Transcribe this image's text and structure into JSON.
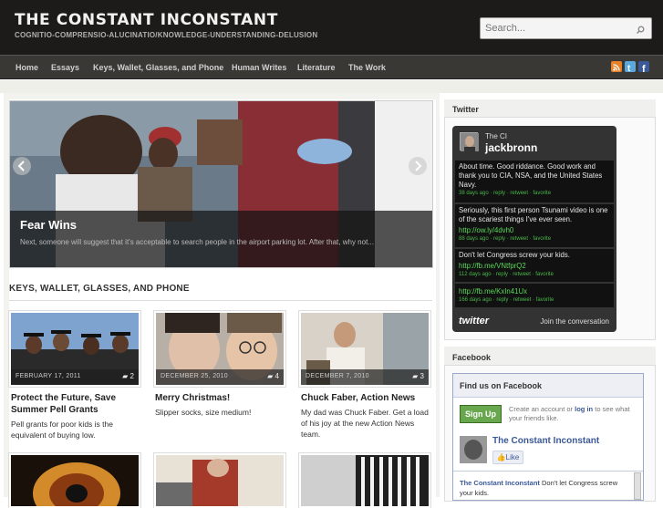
{
  "site": {
    "title": "THE CONSTANT INCONSTANT",
    "tagline": "COGNITIO-COMPRENSIO-ALUCINATIO/KNOWLEDGE-UNDERSTANDING-DELUSION"
  },
  "search": {
    "placeholder": "Search..."
  },
  "nav": {
    "items": [
      "Home",
      "Essays",
      "Keys, Wallet, Glasses, and Phone",
      "Human Writes",
      "Literature",
      "The Work"
    ]
  },
  "slider": {
    "title": "Fear Wins",
    "excerpt": "Next, someone will suggest that it's acceptable to search people in the airport parking lot. After that, why not..."
  },
  "section": {
    "title": "KEYS, WALLET, GLASSES, AND PHONE"
  },
  "posts": [
    {
      "date": "FEBRUARY 17, 2011",
      "comments": "2",
      "title": "Protect the Future, Save Summer Pell Grants",
      "excerpt": "Pell grants for poor kids is the equivalent of buying low."
    },
    {
      "date": "DECEMBER 25, 2010",
      "comments": "4",
      "title": "Merry Christmas!",
      "excerpt": "Slipper socks, size medium!"
    },
    {
      "date": "DECEMBER 7, 2010",
      "comments": "3",
      "title": "Chuck Faber, Action News",
      "excerpt": "My dad was Chuck Faber. Get a load of his joy at the new Action News team."
    }
  ],
  "twitter": {
    "widget_title": "Twitter",
    "profile_name": "The CI",
    "username": "jackbronn",
    "tweets": [
      {
        "text": "About time. Good riddance. Good work and thank you to CIA, NSA, and the United States Navy.",
        "link": "",
        "meta": "38 days ago · reply · retweet · favorite"
      },
      {
        "text": "Seriously, this first person Tsunami video is one of the scariest things I've ever seen.",
        "link": "http://ow.ly/4dvh0",
        "meta": "88 days ago · reply · retweet · favorite"
      },
      {
        "text": "Don't let Congress screw your kids.",
        "link": "http://fb.me/VNtfprQ2",
        "meta": "112 days ago · reply · retweet · favorite"
      },
      {
        "text": "",
        "link": "http://fb.me/KxIn41Ux",
        "meta": "166 days ago · reply · retweet · favorite"
      }
    ],
    "logo": "twitter",
    "join": "Join the conversation"
  },
  "facebook": {
    "widget_title": "Facebook",
    "header": "Find us on Facebook",
    "signup": "Sign Up",
    "create_text": "Create an account or",
    "login": "log in",
    "create_text2": "to see what your friends like.",
    "page_name": "The Constant Inconstant",
    "like": "Like",
    "post_author": "The Constant Inconstant",
    "post_text": "Don't let Congress screw your kids."
  },
  "colors": {
    "header_bg": "#1d1b19",
    "nav_bg": "#3a3835",
    "fb_blue": "#3b5998",
    "twitter_green": "#4ab64a"
  }
}
